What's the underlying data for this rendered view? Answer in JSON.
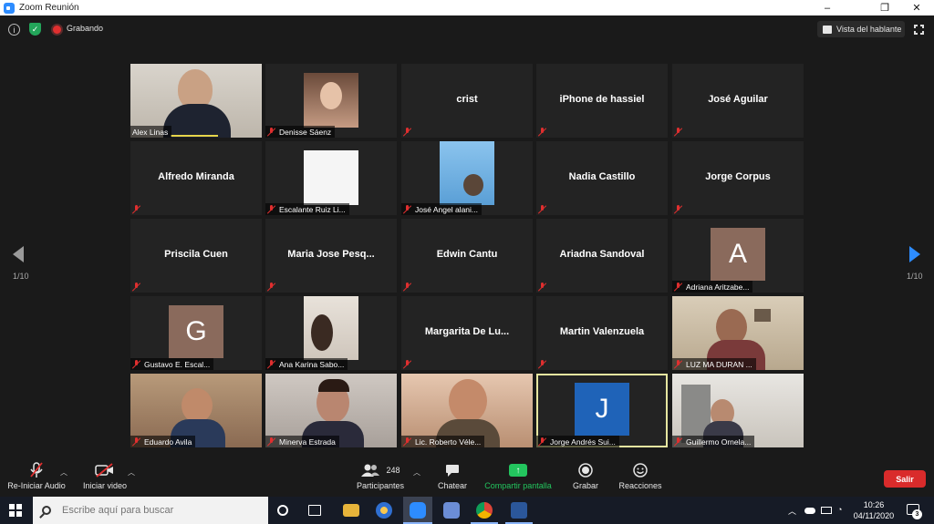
{
  "window": {
    "title": "Zoom Reunión"
  },
  "topbar": {
    "recording_label": "Grabando",
    "view_label": "Vista del hablante"
  },
  "pagination": {
    "left": "1/10",
    "right": "1/10"
  },
  "tiles": [
    {
      "label": "Alex Linas",
      "center": "",
      "muted": false,
      "speaking": true
    },
    {
      "label": "Denisse Sáenz",
      "center": "",
      "muted": true
    },
    {
      "label": "",
      "center": "crist",
      "muted": true
    },
    {
      "label": "",
      "center": "iPhone de hassiel",
      "muted": true
    },
    {
      "label": "",
      "center": "José Aguilar",
      "muted": true
    },
    {
      "label": "",
      "center": "Alfredo Miranda",
      "muted": true
    },
    {
      "label": "Escalante Ruiz Li...",
      "center": "",
      "muted": true
    },
    {
      "label": "José Angel alani...",
      "center": "",
      "muted": true
    },
    {
      "label": "",
      "center": "Nadia Castillo",
      "muted": true
    },
    {
      "label": "",
      "center": "Jorge Corpus",
      "muted": true
    },
    {
      "label": "",
      "center": "Priscila Cuen",
      "muted": true
    },
    {
      "label": "",
      "center": "Maria Jose Pesq...",
      "muted": true
    },
    {
      "label": "",
      "center": "Edwin Cantu",
      "muted": true
    },
    {
      "label": "",
      "center": "Ariadna Sandoval",
      "muted": true
    },
    {
      "label": "Adriana Aritzabe...",
      "center": "",
      "avatar": "A",
      "muted": true
    },
    {
      "label": "Gustavo E. Escal...",
      "center": "",
      "avatar": "G",
      "muted": true
    },
    {
      "label": "Ana Karina Sabo...",
      "center": "",
      "muted": true
    },
    {
      "label": "",
      "center": "Margarita De Lu...",
      "muted": true
    },
    {
      "label": "",
      "center": "Martin Valenzuela",
      "muted": true
    },
    {
      "label": "LUZ MA DURAN ...",
      "center": "",
      "muted": true
    },
    {
      "label": "Eduardo Avila",
      "center": "",
      "muted": true
    },
    {
      "label": "Minerva Estrada",
      "center": "",
      "muted": true
    },
    {
      "label": "Lic. Roberto Véle...",
      "center": "",
      "muted": true
    },
    {
      "label": "Jorge Andrés Sui...",
      "center": "",
      "avatar": "J",
      "muted": true
    },
    {
      "label": "Guillermo Ornela...",
      "center": "",
      "muted": true
    }
  ],
  "controls": {
    "audio": "Re-Iniciar Audio",
    "video": "Iniciar video",
    "participants_count": "248",
    "participants": "Participantes",
    "chat": "Chatear",
    "share": "Compartir pantalla",
    "record": "Grabar",
    "reactions": "Reacciones",
    "exit": "Salir"
  },
  "taskbar": {
    "search_placeholder": "Escribe aquí para buscar",
    "time": "10:26",
    "date": "04/11/2020",
    "notifications": "3"
  },
  "colors": {
    "accent": "#2d8cff",
    "share": "#23c55e",
    "exit": "#d92b2b",
    "mute": "#e02f2f"
  }
}
